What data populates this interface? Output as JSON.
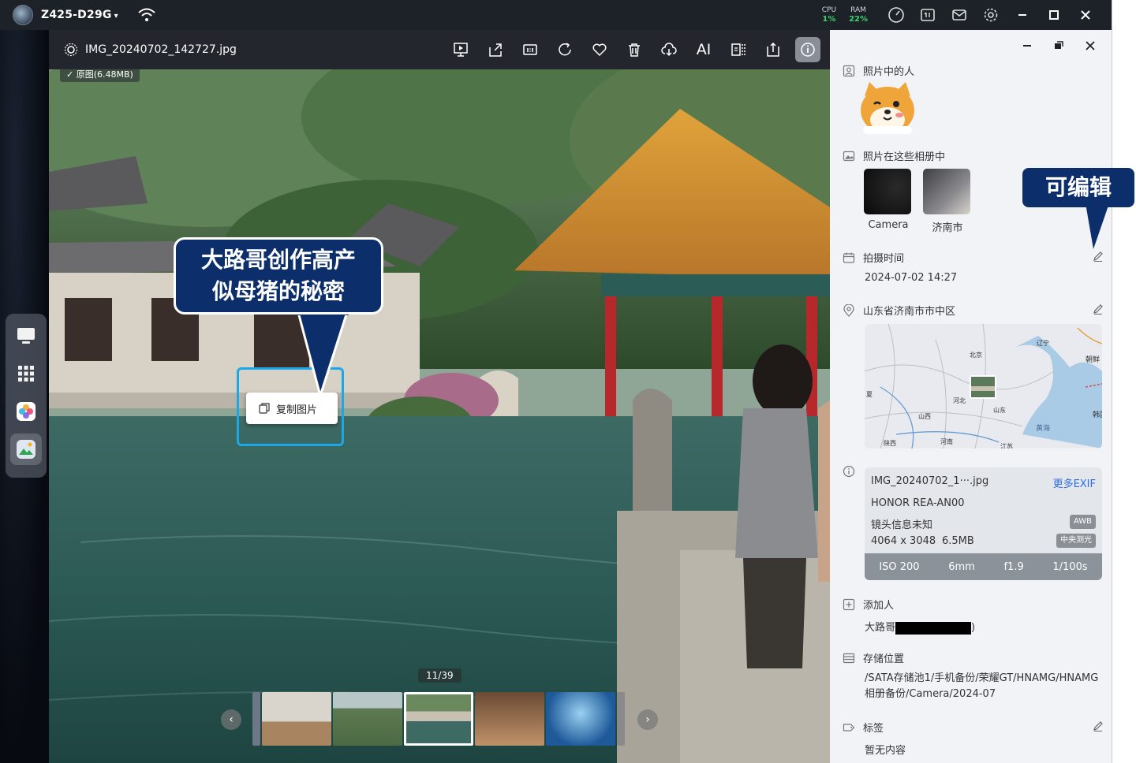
{
  "nas": {
    "device_name": "Z425-D29G",
    "cpu_label": "CPU",
    "cpu_value": "1%",
    "ram_label": "RAM",
    "ram_value": "22%"
  },
  "viewer": {
    "file_name": "IMG_20240702_142727.jpg",
    "original_badge": "✓ 原图(6.48MB)",
    "tools": [
      "slideshow-icon",
      "share-icon",
      "actual-size-icon",
      "rotate-icon",
      "favorite-icon",
      "delete-icon",
      "cloud-download-icon",
      "ai-icon",
      "compare-icon",
      "export-icon",
      "info-icon"
    ],
    "ai_label": "AI",
    "copy_button": "复制图片",
    "counter": "11/39"
  },
  "callouts": {
    "main_line1": "大路哥创作高产",
    "main_line2": "似母猪的秘密",
    "editable": "可编辑"
  },
  "panel": {
    "people_title": "照片中的人",
    "albums_title": "照片在这些相册中",
    "albums": [
      {
        "name": "Camera"
      },
      {
        "name": "济南市"
      }
    ],
    "time_title": "拍摄时间",
    "time_value": "2024-07-02 14:27",
    "location_title": "山东省济南市市中区",
    "map_labels": [
      "辽宁",
      "朝鲜",
      "北京",
      "河北",
      "山东",
      "山西",
      "黄海",
      "韩国",
      "陕西",
      "河南",
      "江苏",
      "夏"
    ],
    "exif": {
      "file": "IMG_20240702_1···.jpg",
      "more": "更多EXIF",
      "device": "HONOR REA-AN00",
      "lens": "镜头信息未知",
      "size": "4064 x 3048",
      "filesize": "6.5MB",
      "awb": "AWB",
      "metering": "中央测光",
      "iso": "ISO 200",
      "focal": "6mm",
      "aperture": "f1.9",
      "shutter": "1/100s"
    },
    "add_person_title": "添加人",
    "add_person_value_prefix": "大路哥",
    "add_person_value_suffix": ")",
    "storage_title": "存储位置",
    "storage_value": "/SATA存储池1/手机备份/荣耀GT/HNAMG/HNAMG相册备份/Camera/2024-07",
    "tags_title": "标签",
    "tags_value": "暂无内容"
  },
  "colors": {
    "callout_bg": "#0c2f6b",
    "highlight": "#1ba8e8",
    "exif_link": "#2f6fe0",
    "status_green": "#3bd16f"
  }
}
